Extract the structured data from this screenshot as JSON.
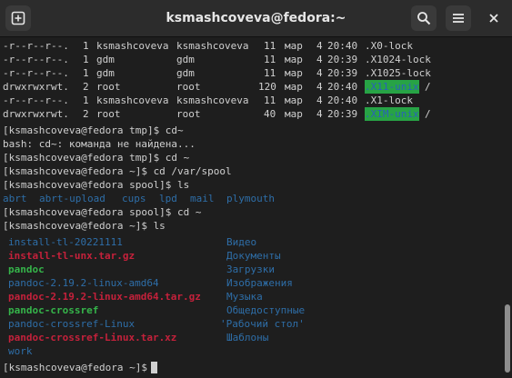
{
  "window": {
    "title": "ksmashcoveva@fedora:~"
  },
  "terminal": {
    "listing": [
      {
        "perm": "-r--r--r--.",
        "links": "1",
        "owner": "ksmashcoveva",
        "group": "ksmashcoveva",
        "size": "11",
        "month": "мар",
        "day": "4",
        "time": "20:40",
        "name": ".X0-lock",
        "kind": "plain"
      },
      {
        "perm": "-r--r--r--.",
        "links": "1",
        "owner": "gdm",
        "group": "gdm",
        "size": "11",
        "month": "мар",
        "day": "4",
        "time": "20:39",
        "name": ".X1024-lock",
        "kind": "plain"
      },
      {
        "perm": "-r--r--r--.",
        "links": "1",
        "owner": "gdm",
        "group": "gdm",
        "size": "11",
        "month": "мар",
        "day": "4",
        "time": "20:39",
        "name": ".X1025-lock",
        "kind": "plain"
      },
      {
        "perm": "drwxrwxrwt.",
        "links": "2",
        "owner": "root",
        "group": "root",
        "size": "120",
        "month": "мар",
        "day": "4",
        "time": "20:40",
        "name": ".X11-unix",
        "kind": "dir-hl"
      },
      {
        "perm": "-r--r--r--.",
        "links": "1",
        "owner": "ksmashcoveva",
        "group": "ksmashcoveva",
        "size": "11",
        "month": "мар",
        "day": "4",
        "time": "20:40",
        "name": ".X1-lock",
        "kind": "plain"
      },
      {
        "perm": "drwxrwxrwt.",
        "links": "2",
        "owner": "root",
        "group": "root",
        "size": "40",
        "month": "мар",
        "day": "4",
        "time": "20:39",
        "name": ".XIM-unix",
        "kind": "dir-hl"
      }
    ],
    "lines": {
      "l7": "[ksmashcoveva@fedora tmp]$ cd~",
      "l8": "bash: cd~: команда не найдена...",
      "l9": "[ksmashcoveva@fedora tmp]$ cd ~",
      "l10": "[ksmashcoveva@fedora ~]$ cd /var/spool",
      "l11": "[ksmashcoveva@fedora spool]$ ls",
      "l13": "[ksmashcoveva@fedora spool]$ cd ~",
      "l14": "[ksmashcoveva@fedora ~]$ ls",
      "l24": "[ksmashcoveva@fedora ~]$ "
    },
    "spool_ls": [
      "abrt",
      "abrt-upload",
      "cups",
      "lpd",
      "mail",
      "plymouth"
    ],
    "home_left": [
      {
        "name": "install-tl-20221111",
        "color": "blue"
      },
      {
        "name": "install-tl-unx.tar.gz",
        "color": "red"
      },
      {
        "name": "pandoc",
        "color": "green"
      },
      {
        "name": "pandoc-2.19.2-linux-amd64",
        "color": "blue"
      },
      {
        "name": "pandoc-2.19.2-linux-amd64.tar.gz",
        "color": "red"
      },
      {
        "name": "pandoc-crossref",
        "color": "green"
      },
      {
        "name": "pandoc-crossref-Linux",
        "color": "blue"
      },
      {
        "name": "pandoc-crossref-Linux.tar.xz",
        "color": "red"
      },
      {
        "name": "work",
        "color": "blue"
      }
    ],
    "home_right": [
      "Видео",
      "Документы",
      "Загрузки",
      "Изображения",
      "Музыка",
      "Общедоступные",
      "'Рабочий стол'",
      "Шаблоны"
    ],
    "slash": "/"
  },
  "colors": {
    "background": "#1e1e1e",
    "titlebar": "#2c2c2c",
    "text": "#d0d0d0",
    "directory": "#2e6ea8",
    "archive": "#c4213b",
    "executable": "#35b44a",
    "highlight_bg": "#27a345"
  },
  "icons": [
    "new-tab-icon",
    "search-icon",
    "hamburger-menu-icon",
    "close-icon"
  ]
}
